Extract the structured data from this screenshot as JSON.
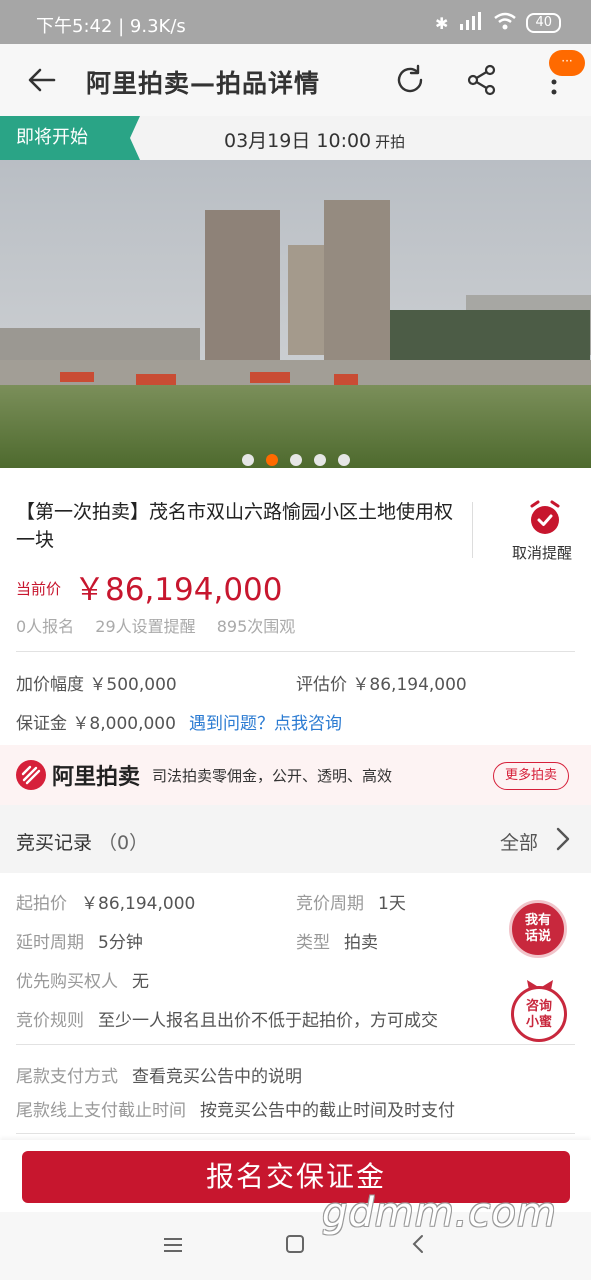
{
  "status_bar": {
    "time": "下午5:42 | 9.3K/s",
    "battery": "40"
  },
  "header": {
    "title": "阿里拍卖—拍品详情",
    "badge": "···"
  },
  "start_bar": {
    "tag": "即将开始",
    "datetime": "03月19日 10:00",
    "suffix": "开拍"
  },
  "carousel": {
    "total": 5,
    "active_index": 1
  },
  "item": {
    "title": "【第一次拍卖】茂名市双山六路愉园小区土地使用权一块",
    "remind_label": "取消提醒",
    "current_price_label": "当前价",
    "current_price": "￥86,194,000",
    "stats": [
      "0人报名",
      "29人设置提醒",
      "895次围观"
    ]
  },
  "info": {
    "increment": "加价幅度 ￥500,000",
    "appraisal": "评估价 ￥86,194,000",
    "deposit": "保证金 ￥8,000,000",
    "help_link": "遇到问题？点我咨询"
  },
  "banner": {
    "brand": "阿里拍卖",
    "slogan": "司法拍卖零佣金，公开、透明、高效",
    "more_button": "更多拍卖"
  },
  "bid_record": {
    "title": "竞买记录",
    "count": "（0）",
    "all": "全部"
  },
  "details": {
    "start_price_label": "起拍价",
    "start_price": "￥86,194,000",
    "cycle_label": "竞价周期",
    "cycle": "1天",
    "delay_label": "延时周期",
    "delay": "5分钟",
    "type_label": "类型",
    "type": "拍卖",
    "priority_label": "优先购买权人",
    "priority": "无",
    "rule_label": "竞价规则",
    "rule": "至少一人报名且出价不低于起拍价，方可成交",
    "payment_label": "尾款支付方式",
    "payment": "查看竞买公告中的说明",
    "deadline_label": "尾款线上支付截止时间",
    "deadline": "按竞买公告中的截止时间及时支付"
  },
  "float_buttons": {
    "talk": [
      "我有",
      "话说"
    ],
    "consult": [
      "咨询",
      "小蜜"
    ]
  },
  "primary_button": "报名交保证金",
  "watermark": "gdmm.com",
  "colors": {
    "accent_red": "#c7162e",
    "green_tag": "#2aa486",
    "orange": "#ff6a00"
  }
}
